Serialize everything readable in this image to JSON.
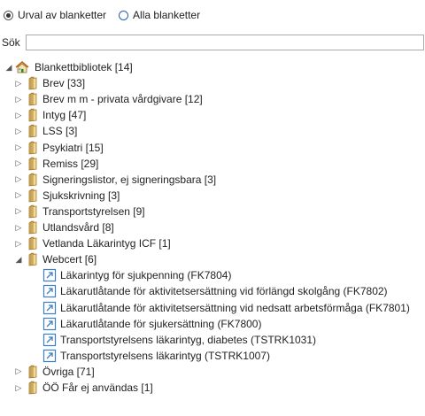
{
  "radio": {
    "option1": "Urval av blanketter",
    "option2": "Alla blanketter"
  },
  "search": {
    "label": "Sök",
    "value": "",
    "placeholder": ""
  },
  "tree": {
    "root": "Blankettbibliotek [14]",
    "folders": [
      "Brev [33]",
      "Brev m m - privata vårdgivare [12]",
      "Intyg [47]",
      "LSS [3]",
      "Psykiatri [15]",
      "Remiss [29]",
      "Signeringslistor, ej signeringsbara [3]",
      "Sjukskrivning [3]",
      "Transportstyrelsen [9]",
      "Utlandsvård [8]",
      "Vetlanda Läkarintyg ICF [1]",
      "Webcert [6]"
    ],
    "webcert_items": [
      "Läkarintyg för sjukpenning (FK7804)",
      "Läkarutlåtande för aktivitetsersättning vid förlängd skolgång (FK7802)",
      "Läkarutlåtande för aktivitetsersättning vid nedsatt arbetsförmåga (FK7801)",
      "Läkarutlåtande för sjukersättning (FK7800)",
      "Transportstyrelsens läkarintyg, diabetes (TSTRK1031)",
      "Transportstyrelsens läkarintyg (TSTRK1007)"
    ],
    "after": [
      "Övriga [71]",
      "ÖÖ Får ej användas [1]"
    ]
  }
}
